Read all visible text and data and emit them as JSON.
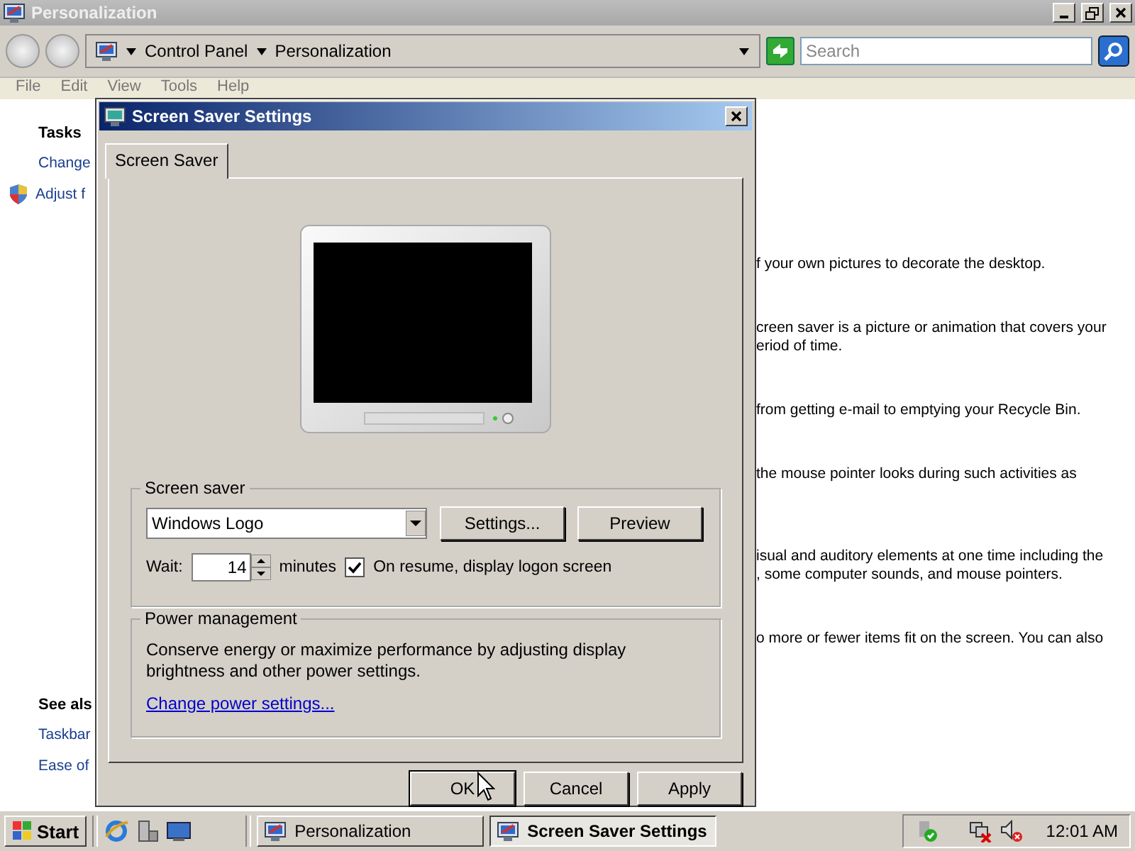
{
  "window": {
    "title": "Personalization"
  },
  "address_bar": {
    "crumbs": [
      "Control Panel",
      "Personalization"
    ],
    "search": {
      "placeholder": "Search"
    }
  },
  "menu": [
    "File",
    "Edit",
    "View",
    "Tools",
    "Help"
  ],
  "sidebar": {
    "tasks_heading": "Tasks",
    "tasks": [
      "Change",
      "Adjust f"
    ],
    "see_also_heading": "See als",
    "see_also": [
      "Taskbar",
      "Ease of"
    ]
  },
  "content_fragments": [
    [
      "f your own pictures to decorate the desktop."
    ],
    [
      "creen saver is a picture or animation that covers your",
      "eriod of time."
    ],
    [
      "from getting e-mail to emptying your Recycle Bin."
    ],
    [
      "the mouse pointer looks during such activities as"
    ],
    [
      "isual and auditory elements at one time including the",
      ", some computer sounds, and mouse pointers."
    ],
    [
      "o more or fewer items fit on the screen. You can also"
    ]
  ],
  "dialog": {
    "title": "Screen Saver Settings",
    "tabs": [
      {
        "label": "Screen Saver",
        "selected": true
      }
    ],
    "screen_saver": {
      "legend": "Screen saver",
      "selected_saver": "Windows Logo",
      "settings_button": "Settings...",
      "preview_button": "Preview",
      "wait_label": "Wait:",
      "wait_value": "14",
      "minutes": "minutes",
      "logon": {
        "label": "On resume, display logon screen",
        "checked": true
      }
    },
    "power": {
      "legend": "Power management",
      "text": "Conserve energy or maximize performance by adjusting display brightness and other power settings.",
      "link": "Change power settings..."
    },
    "buttons": [
      "OK",
      "Cancel",
      "Apply"
    ]
  },
  "taskbar": {
    "start": "Start",
    "tasks": [
      {
        "label": "Personalization",
        "selected": false
      },
      {
        "label": "Screen Saver Settings",
        "selected": true
      }
    ],
    "clock": "12:01 AM"
  }
}
